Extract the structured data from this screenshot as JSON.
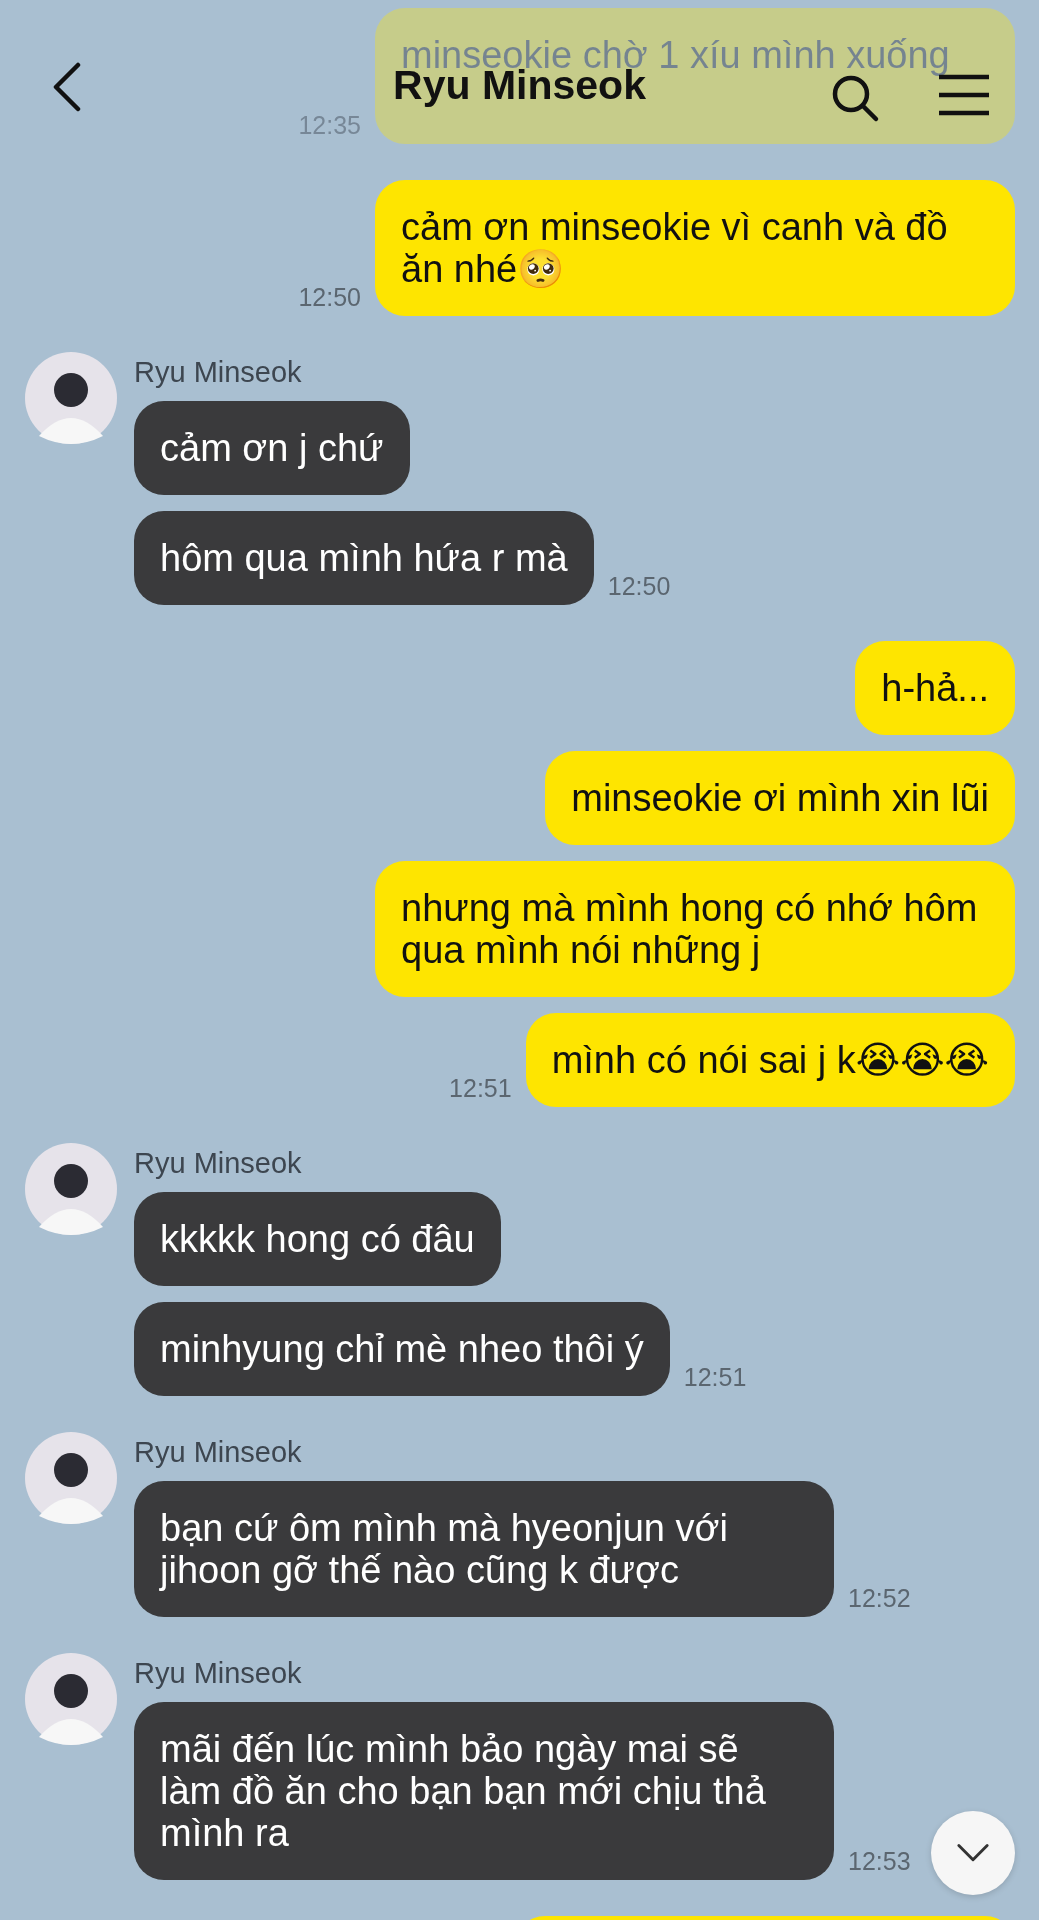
{
  "header": {
    "title": "Ryu Minseok"
  },
  "messages": [
    {
      "kind": "sent",
      "dimmed": true,
      "bubbles": [
        "minseokie chờ 1 xíu mình xuống"
      ],
      "time": "12:35"
    },
    {
      "kind": "sent",
      "dimmed": false,
      "bubbles": [
        "cảm ơn minseokie vì canh và đồ ăn nhé🥺"
      ],
      "time": "12:50"
    },
    {
      "kind": "received",
      "dimmed": false,
      "sender": "Ryu Minseok",
      "bubbles": [
        "cảm ơn j chứ",
        "hôm qua mình hứa r mà"
      ],
      "time": "12:50"
    },
    {
      "kind": "sent",
      "dimmed": false,
      "bubbles": [
        "h-hả...",
        "minseokie ơi mình xin lũi",
        "nhưng mà mình hong có nhớ hôm qua mình nói những j",
        "mình có nói sai j k😭😭😭"
      ],
      "time": "12:51"
    },
    {
      "kind": "received",
      "dimmed": false,
      "sender": "Ryu Minseok",
      "bubbles": [
        "kkkkk hong có đâu",
        "minhyung chỉ mè nheo thôi ý"
      ],
      "time": "12:51"
    },
    {
      "kind": "received",
      "dimmed": false,
      "sender": "Ryu Minseok",
      "bubbles": [
        "bạn cứ ôm mình mà hyeonjun với jihoon gỡ thế nào cũng k được"
      ],
      "time": "12:52"
    },
    {
      "kind": "received",
      "dimmed": false,
      "sender": "Ryu Minseok",
      "bubbles": [
        "mãi đến lúc mình bảo ngày mai sẽ làm đồ ăn cho bạn bạn mới chịu thả mình ra"
      ],
      "time": "12:53"
    },
    {
      "kind": "partial"
    }
  ]
}
